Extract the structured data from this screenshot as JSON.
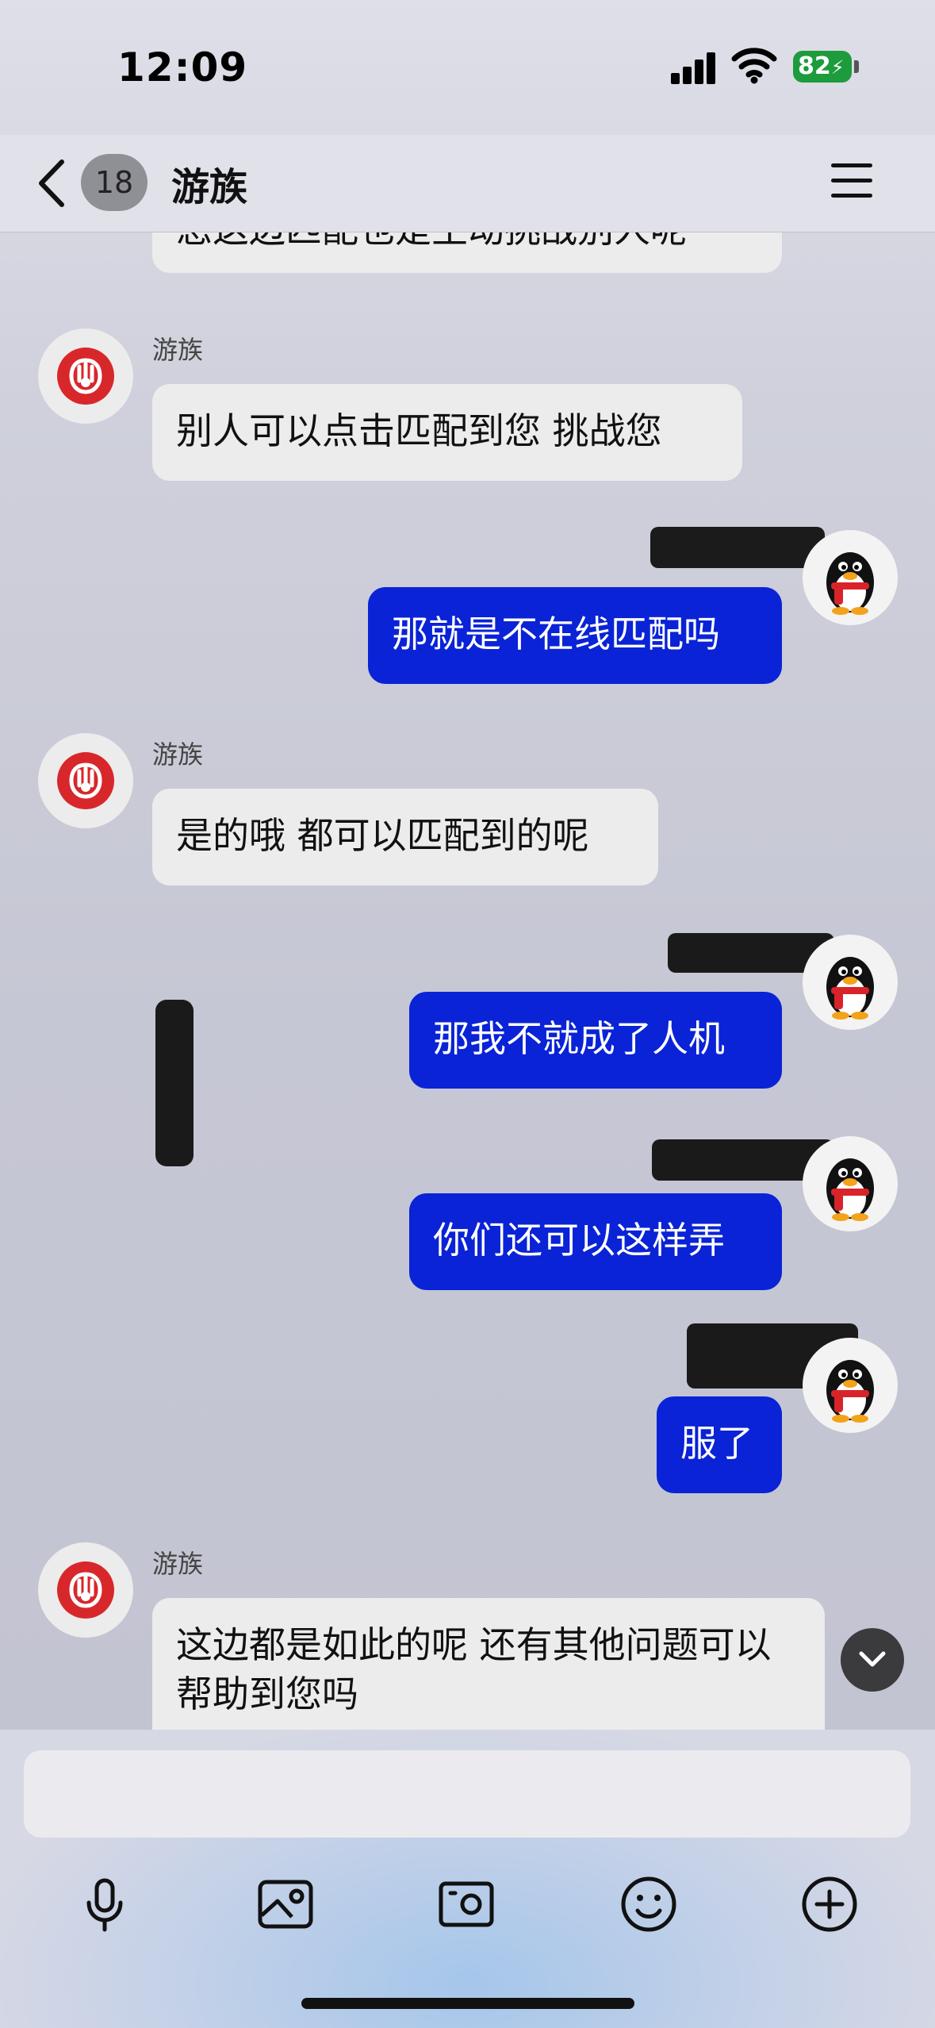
{
  "status_bar": {
    "time": "12:09",
    "battery": "82"
  },
  "nav": {
    "unread_count": "18",
    "title": "游族"
  },
  "messages": [
    {
      "from": "them",
      "text": "您这边匹配也是主动挑战别人呢"
    },
    {
      "from": "them",
      "sender": "游族",
      "text": "别人可以点击匹配到您 挑战您"
    },
    {
      "from": "me",
      "text": "那就是不在线匹配吗"
    },
    {
      "from": "them",
      "sender": "游族",
      "text": "是的哦 都可以匹配到的呢"
    },
    {
      "from": "me",
      "text": "那我不就成了人机"
    },
    {
      "from": "me",
      "text": "你们还可以这样弄"
    },
    {
      "from": "me",
      "text": "服了"
    },
    {
      "from": "them",
      "sender": "游族",
      "text": "这边都是如此的呢 还有其他问题可以帮助到您吗"
    }
  ],
  "colors": {
    "outgoing_bubble": "#0a23d6",
    "incoming_bubble": "#ececec",
    "battery": "#1e9b3c"
  },
  "toolbar": [
    "microphone-icon",
    "image-icon",
    "camera-icon",
    "emoji-icon",
    "plus-icon"
  ]
}
